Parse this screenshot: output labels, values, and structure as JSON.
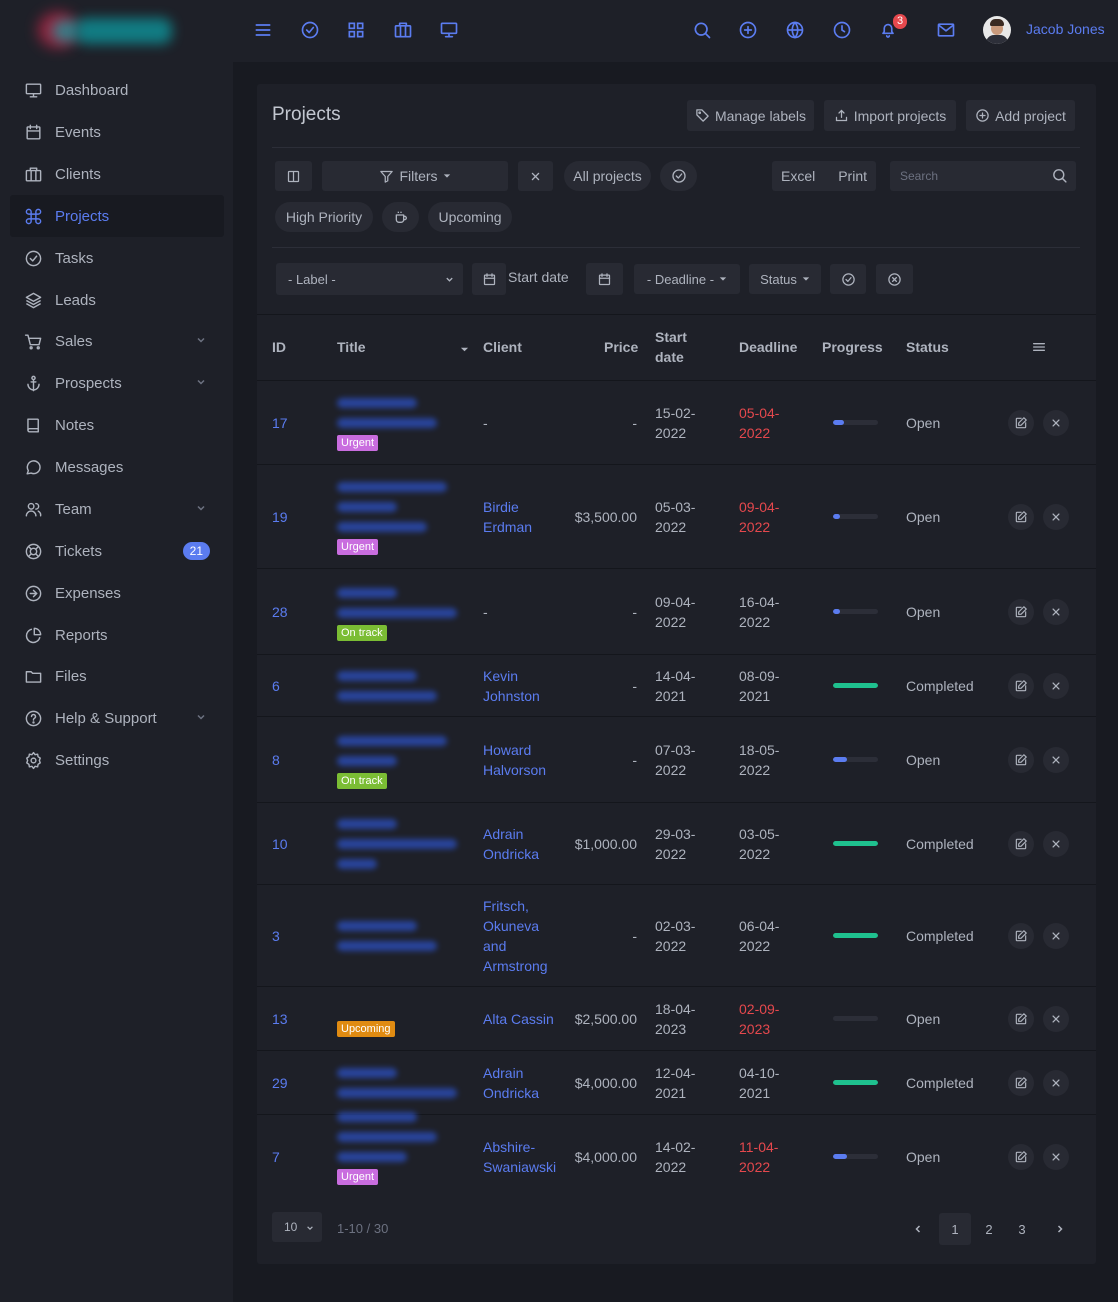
{
  "user": {
    "name": "Jacob Jones"
  },
  "notifications_count": "3",
  "sidebar": {
    "items": [
      {
        "label": "Dashboard",
        "icon": "monitor-icon"
      },
      {
        "label": "Events",
        "icon": "calendar-icon"
      },
      {
        "label": "Clients",
        "icon": "briefcase-icon"
      },
      {
        "label": "Projects",
        "icon": "command-icon",
        "active": true
      },
      {
        "label": "Tasks",
        "icon": "check-circle-icon"
      },
      {
        "label": "Leads",
        "icon": "layers-icon"
      },
      {
        "label": "Sales",
        "icon": "cart-icon",
        "has_children": true
      },
      {
        "label": "Prospects",
        "icon": "anchor-icon",
        "has_children": true
      },
      {
        "label": "Notes",
        "icon": "book-icon"
      },
      {
        "label": "Messages",
        "icon": "message-icon"
      },
      {
        "label": "Team",
        "icon": "users-icon",
        "has_children": true
      },
      {
        "label": "Tickets",
        "icon": "lifebuoy-icon",
        "badge": "21"
      },
      {
        "label": "Expenses",
        "icon": "arrow-circle-icon"
      },
      {
        "label": "Reports",
        "icon": "pie-chart-icon"
      },
      {
        "label": "Files",
        "icon": "folder-icon"
      },
      {
        "label": "Help & Support",
        "icon": "help-circle-icon",
        "has_children": true
      },
      {
        "label": "Settings",
        "icon": "settings-icon"
      }
    ]
  },
  "page": {
    "title": "Projects",
    "buttons": {
      "manage_labels": "Manage labels",
      "import_projects": "Import projects",
      "add_project": "Add project"
    },
    "toolbar": {
      "filters": "Filters",
      "all_projects": "All projects",
      "excel": "Excel",
      "print": "Print",
      "search_placeholder": "Search",
      "high_priority": "High Priority",
      "upcoming": "Upcoming",
      "label_select": "- Label -",
      "start_date": "Start date",
      "deadline": "- Deadline -",
      "status": "Status"
    }
  },
  "table": {
    "columns": {
      "id": "ID",
      "title": "Title",
      "client": "Client",
      "price": "Price",
      "start_date": "Start date",
      "deadline": "Deadline",
      "progress": "Progress",
      "status": "Status"
    },
    "rows": [
      {
        "id": "17",
        "client": "-",
        "price": "-",
        "start": "15-02-2022",
        "deadline": "05-04-2022",
        "deadline_overdue": true,
        "progress": 0.25,
        "status": "Open",
        "tag": "Urgent"
      },
      {
        "id": "19",
        "client": "Birdie Erdman",
        "price": "$3,500.00",
        "start": "05-03-2022",
        "deadline": "09-04-2022",
        "deadline_overdue": true,
        "progress": 0.15,
        "status": "Open",
        "tag": "Urgent"
      },
      {
        "id": "28",
        "client": "-",
        "price": "-",
        "start": "09-04-2022",
        "deadline": "16-04-2022",
        "deadline_overdue": false,
        "progress": 0.15,
        "status": "Open",
        "tag": "On track"
      },
      {
        "id": "6",
        "client": "Kevin Johnston",
        "price": "-",
        "start": "14-04-2021",
        "deadline": "08-09-2021",
        "deadline_overdue": false,
        "progress": 1.0,
        "status": "Completed",
        "tag": ""
      },
      {
        "id": "8",
        "client": "Howard Halvorson",
        "price": "-",
        "start": "07-03-2022",
        "deadline": "18-05-2022",
        "deadline_overdue": false,
        "progress": 0.3,
        "status": "Open",
        "tag": "On track"
      },
      {
        "id": "10",
        "client": "Adrain Ondricka",
        "price": "$1,000.00",
        "start": "29-03-2022",
        "deadline": "03-05-2022",
        "deadline_overdue": false,
        "progress": 1.0,
        "status": "Completed",
        "tag": ""
      },
      {
        "id": "3",
        "client": "Fritsch, Okuneva and Armstrong",
        "price": "-",
        "start": "02-03-2022",
        "deadline": "06-04-2022",
        "deadline_overdue": false,
        "progress": 1.0,
        "status": "Completed",
        "tag": ""
      },
      {
        "id": "13",
        "client": "Alta Cassin",
        "price": "$2,500.00",
        "start": "18-04-2023",
        "deadline": "02-09-2023",
        "deadline_overdue": true,
        "progress": 0.0,
        "status": "Open",
        "tag": "Upcoming"
      },
      {
        "id": "29",
        "client": "Adrain Ondricka",
        "price": "$4,000.00",
        "start": "12-04-2021",
        "deadline": "04-10-2021",
        "deadline_overdue": false,
        "progress": 1.0,
        "status": "Completed",
        "tag": ""
      },
      {
        "id": "7",
        "client": "Abshire-Swaniawski",
        "price": "$4,000.00",
        "start": "14-02-2022",
        "deadline": "11-04-2022",
        "deadline_overdue": true,
        "progress": 0.3,
        "status": "Open",
        "tag": "Urgent"
      }
    ]
  },
  "pagination": {
    "page_size": "10",
    "info": "1-10 / 30",
    "pages": [
      "1",
      "2",
      "3"
    ],
    "current": "1"
  },
  "colors": {
    "accent": "#5b7cf0",
    "danger": "#e5484d",
    "success": "#1fc18f",
    "urgent": "#c96ddf",
    "ontrack": "#7bbd34",
    "upcoming": "#e08b12"
  }
}
